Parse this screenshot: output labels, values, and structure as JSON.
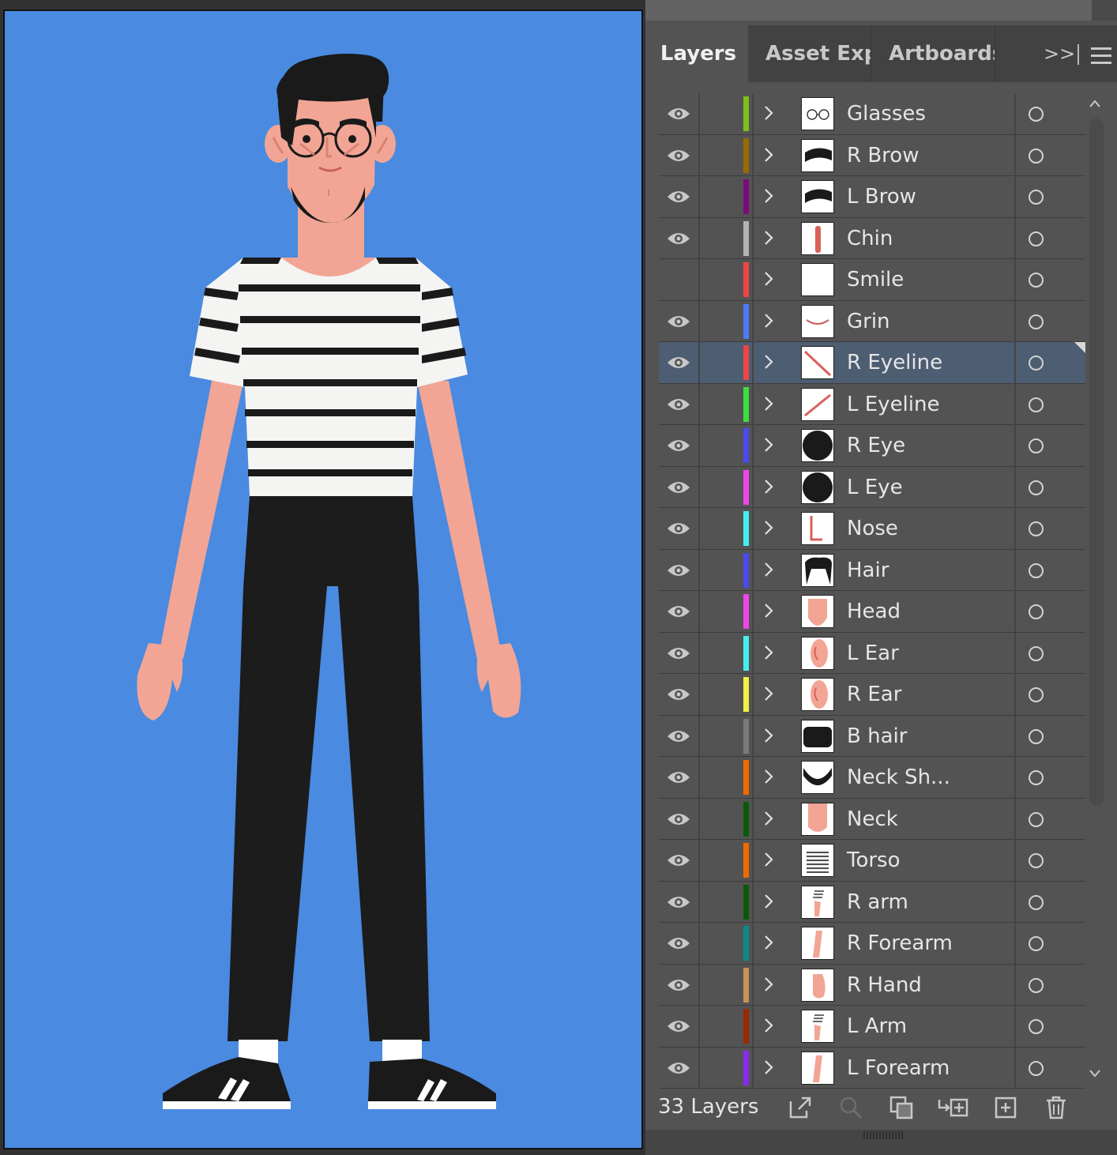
{
  "tabs": [
    {
      "label": "Layers",
      "active": true
    },
    {
      "label": "Asset Expo",
      "active": false
    },
    {
      "label": "Artboards",
      "active": false
    }
  ],
  "tab_overflow_label": ">>",
  "layers": [
    {
      "name": "Glasses",
      "color": "#7fbf1a",
      "visible": true,
      "thumb": "glasses"
    },
    {
      "name": "R Brow",
      "color": "#9a6a00",
      "visible": true,
      "thumb": "brow"
    },
    {
      "name": "L Brow",
      "color": "#7a0c7a",
      "visible": true,
      "thumb": "brow"
    },
    {
      "name": "Chin",
      "color": "#b4b4b4",
      "visible": true,
      "thumb": "chin"
    },
    {
      "name": "Smile",
      "color": "#f04545",
      "visible": false,
      "thumb": "blank"
    },
    {
      "name": "Grin",
      "color": "#4a7cf5",
      "visible": true,
      "thumb": "grin"
    },
    {
      "name": "R Eyeline",
      "color": "#f04545",
      "visible": true,
      "thumb": "eyeline-r",
      "selected": true
    },
    {
      "name": "L Eyeline",
      "color": "#3ce03c",
      "visible": true,
      "thumb": "eyeline-l"
    },
    {
      "name": "R Eye",
      "color": "#4a4af0",
      "visible": true,
      "thumb": "eye"
    },
    {
      "name": "L Eye",
      "color": "#f045e8",
      "visible": true,
      "thumb": "eye"
    },
    {
      "name": "Nose",
      "color": "#45eef0",
      "visible": true,
      "thumb": "nose"
    },
    {
      "name": "Hair",
      "color": "#4a4af0",
      "visible": true,
      "thumb": "hair"
    },
    {
      "name": "Head",
      "color": "#f045e8",
      "visible": true,
      "thumb": "head"
    },
    {
      "name": "L Ear",
      "color": "#45eef0",
      "visible": true,
      "thumb": "ear"
    },
    {
      "name": "R Ear",
      "color": "#f0f045",
      "visible": true,
      "thumb": "ear"
    },
    {
      "name": "B hair",
      "color": "#7a7a7a",
      "visible": true,
      "thumb": "bhair"
    },
    {
      "name": "Neck Sh...",
      "color": "#f06a00",
      "visible": true,
      "thumb": "necksh"
    },
    {
      "name": "Neck",
      "color": "#0a5a0a",
      "visible": true,
      "thumb": "neck"
    },
    {
      "name": "Torso",
      "color": "#f06a00",
      "visible": true,
      "thumb": "torso"
    },
    {
      "name": "R arm",
      "color": "#0a5a0a",
      "visible": true,
      "thumb": "arm"
    },
    {
      "name": "R Forearm",
      "color": "#0a8a8a",
      "visible": true,
      "thumb": "forearm"
    },
    {
      "name": "R Hand",
      "color": "#c8905a",
      "visible": true,
      "thumb": "hand"
    },
    {
      "name": "L Arm",
      "color": "#9a2a00",
      "visible": true,
      "thumb": "arm"
    },
    {
      "name": "L Forearm",
      "color": "#8a2af0",
      "visible": true,
      "thumb": "forearm"
    }
  ],
  "footer": {
    "layer_count": "33 Layers",
    "icons": [
      "export-icon",
      "locate-object-icon",
      "clipping-mask-icon",
      "new-sublayer-icon",
      "new-layer-icon",
      "delete-layer-icon"
    ]
  },
  "colors": {
    "artboard_bg": "#4a8ae0",
    "skin": "#f2a595",
    "hair": "#1a1a1a",
    "shirt": "#f4f4f2",
    "pants": "#1c1c1c",
    "selected_row": "#4d5d72"
  }
}
